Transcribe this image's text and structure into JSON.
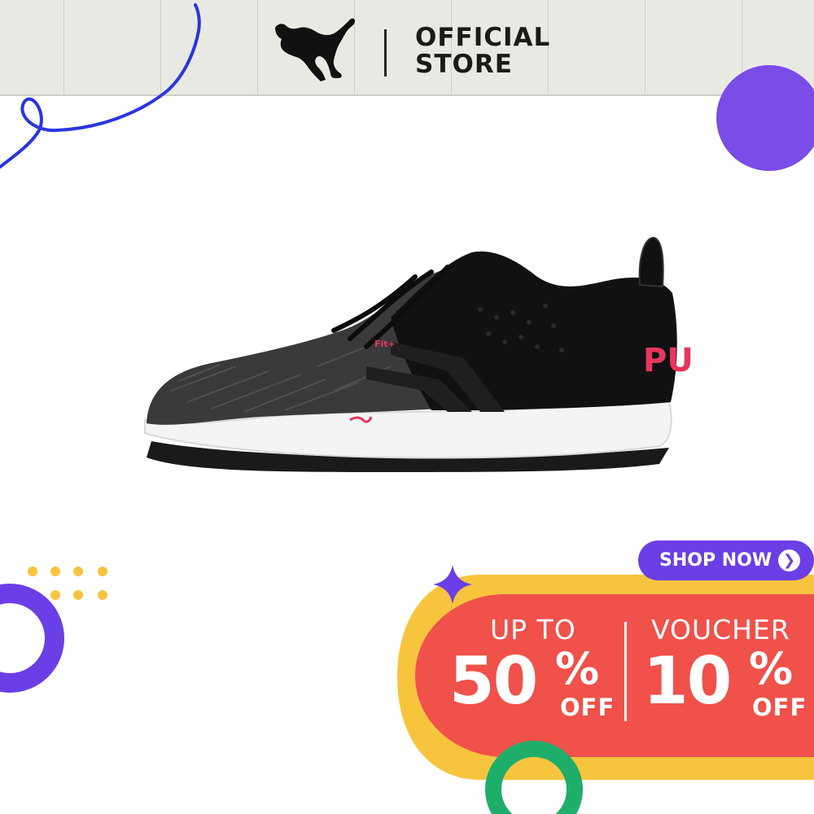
{
  "header": {
    "brand_line1": "OFFICIAL",
    "brand_line2": "STORE",
    "logo_icon": "puma-cat-logo-icon"
  },
  "product": {
    "image_icon": "running-shoe-image",
    "tongue_label": "Fit+"
  },
  "promo": {
    "left_label": "UP TO",
    "left_value": "50",
    "left_percent": "%",
    "left_off": "OFF",
    "right_label": "VOUCHER",
    "right_value": "10",
    "right_percent": "%",
    "right_off": "OFF",
    "shop_button": "SHOP NOW",
    "shop_arrow_icon": "chevron-right-icon"
  },
  "colors": {
    "header_bg": "#e9e9e4",
    "purple": "#6b3fe6",
    "promo_red": "#f0514a",
    "promo_yellow": "#f7c43e",
    "accent_blue": "#2a36e0",
    "accent_green": "#1fae6a",
    "accent_pink": "#e8365d"
  }
}
